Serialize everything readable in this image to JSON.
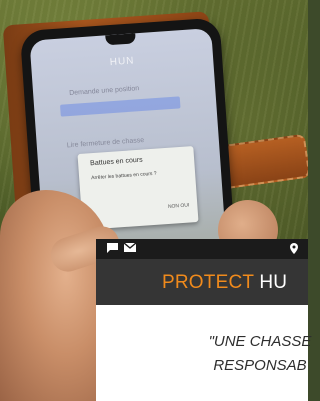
{
  "photo": {
    "phone_screen": {
      "title": "HUN",
      "text_line_1": "Demande une position",
      "text_line_2": "Lire fermeture de chasse",
      "popup": {
        "title": "Battues en cours",
        "text": "Arrêter les battues en cours ?",
        "buttons": "NON   OUI"
      }
    }
  },
  "overlay": {
    "status_bar": {
      "icons": [
        "message-icon",
        "mail-icon",
        "location-pin-icon"
      ]
    },
    "brand": {
      "part1": "PROTECT",
      "part2": "HU"
    },
    "quote": {
      "line1": "\"UNE CHASSE",
      "line2": "RESPONSAB"
    }
  }
}
